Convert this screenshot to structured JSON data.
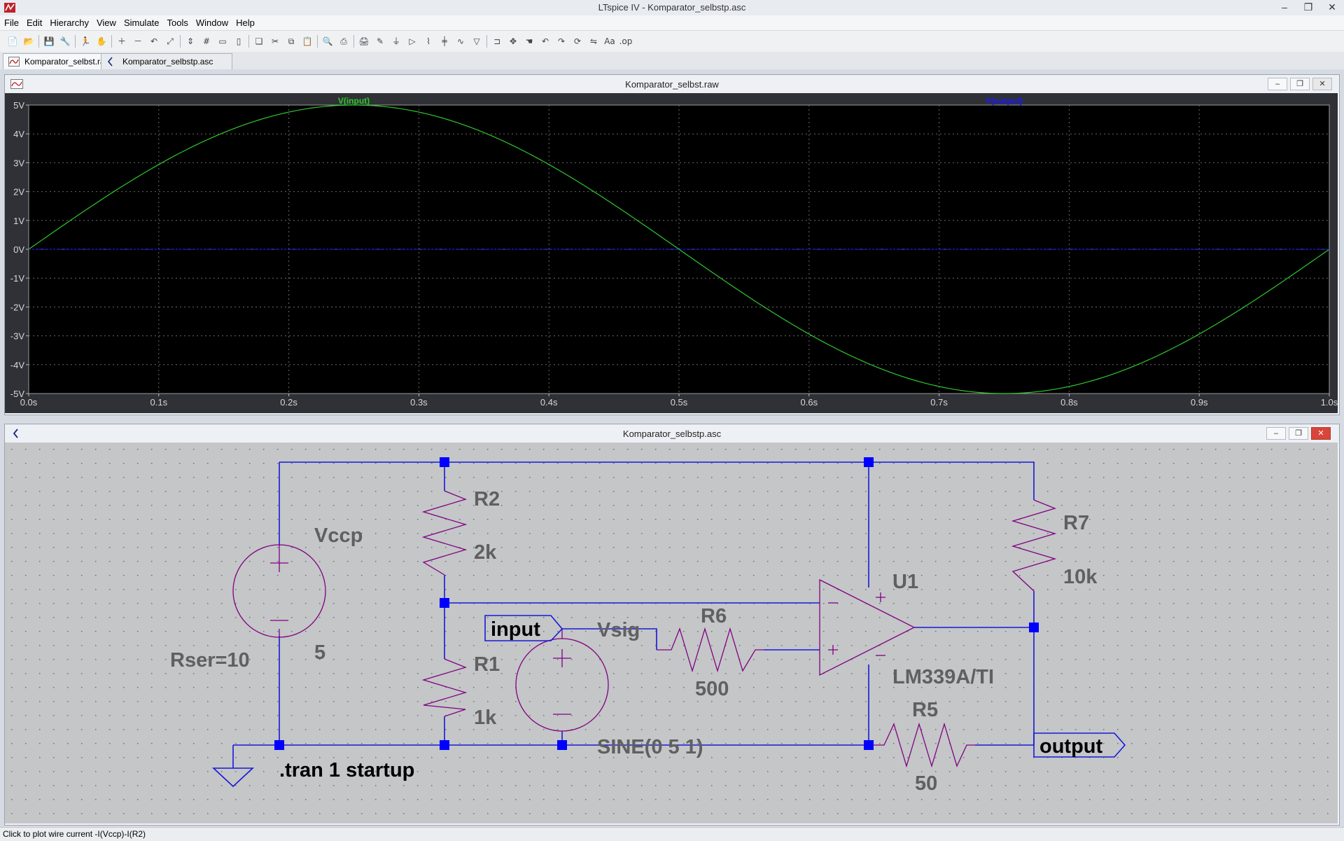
{
  "app": {
    "title": "LTspice IV - Komparator_selbstp.asc",
    "window_controls": [
      "–",
      "❐",
      "✕"
    ]
  },
  "menu": [
    "File",
    "Edit",
    "Hierarchy",
    "View",
    "Simulate",
    "Tools",
    "Window",
    "Help"
  ],
  "toolbar_icons": [
    "new-schematic-icon",
    "open-icon",
    "save-icon",
    "control-panel-icon",
    "run-icon",
    "pan-icon",
    "zoom-in-icon",
    "zoom-out-icon",
    "zoom-back-icon",
    "zoom-fit-icon",
    "autorange-icon",
    "grid-icon",
    "tile-horizontal-icon",
    "tile-vertical-icon",
    "cascade-icon",
    "cut-icon",
    "copy-icon",
    "paste-icon",
    "find-icon",
    "print-setup-icon",
    "print-icon",
    "wire-icon",
    "ground-icon",
    "label-icon",
    "resistor-icon",
    "capacitor-icon",
    "inductor-icon",
    "diode-icon",
    "component-icon",
    "move-icon",
    "drag-icon",
    "undo-icon",
    "redo-icon",
    "rotate-icon",
    "mirror-icon",
    "text-icon",
    "spice-directive-icon"
  ],
  "tabs": [
    {
      "label": "Komparator_selbst.raw",
      "icon": "waveform-icon",
      "active": true
    },
    {
      "label": "Komparator_selbstp.asc",
      "icon": "schematic-icon",
      "active": false
    }
  ],
  "waveform_window": {
    "title": "Komparator_selbst.raw",
    "buttons": [
      "–",
      "❐",
      "✕"
    ]
  },
  "schematic_window": {
    "title": "Komparator_selbstp.asc",
    "buttons": [
      "–",
      "❐",
      "✕"
    ]
  },
  "chart_data": {
    "type": "line",
    "title": "",
    "xlabel": "",
    "ylabel": "",
    "xlim": [
      0,
      1
    ],
    "ylim": [
      -5,
      5
    ],
    "x_tick_labels": [
      "0.0s",
      "0.1s",
      "0.2s",
      "0.3s",
      "0.4s",
      "0.5s",
      "0.6s",
      "0.7s",
      "0.8s",
      "0.9s",
      "1.0s"
    ],
    "y_tick_labels": [
      "5V",
      "4V",
      "3V",
      "2V",
      "1V",
      "0V",
      "-1V",
      "-2V",
      "-3V",
      "-4V",
      "-5V"
    ],
    "grid": true,
    "background": "#000000",
    "series": [
      {
        "name": "V(input)",
        "color": "#2ec82e",
        "function": "5*sin(2*pi*t)",
        "x": [
          0,
          0.05,
          0.1,
          0.15,
          0.2,
          0.25,
          0.3,
          0.35,
          0.4,
          0.45,
          0.5,
          0.55,
          0.6,
          0.65,
          0.7,
          0.75,
          0.8,
          0.85,
          0.9,
          0.95,
          1.0
        ],
        "values": [
          0,
          1.545,
          2.939,
          4.045,
          4.755,
          5,
          4.755,
          4.045,
          2.939,
          1.545,
          0,
          -1.545,
          -2.939,
          -4.045,
          -4.755,
          -5,
          -4.755,
          -4.045,
          -2.939,
          -1.545,
          0
        ]
      },
      {
        "name": "V(output)",
        "color": "#1a1aff",
        "x": [
          0,
          1
        ],
        "values": [
          0,
          0
        ]
      }
    ]
  },
  "schematic": {
    "components": {
      "vccp": {
        "name": "Vccp",
        "value": "5",
        "extra": "Rser=10"
      },
      "r2": {
        "name": "R2",
        "value": "2k"
      },
      "r1": {
        "name": "R1",
        "value": "1k"
      },
      "vsig": {
        "name": "Vsig",
        "value": "SINE(0 5 1)"
      },
      "r6": {
        "name": "R6",
        "value": "500"
      },
      "u1": {
        "name": "U1",
        "value": "LM339A/TI"
      },
      "r7": {
        "name": "R7",
        "value": "10k"
      },
      "r5": {
        "name": "R5",
        "value": "50"
      }
    },
    "net_labels": {
      "input": "input",
      "output": "output"
    },
    "directive": ".tran 1 startup",
    "colors": {
      "wire": "#1818d8",
      "component": "#800080",
      "junction": "#0000ff",
      "label": "#606060"
    }
  },
  "status": "Click to plot wire current -I(Vccp)-I(R2)"
}
